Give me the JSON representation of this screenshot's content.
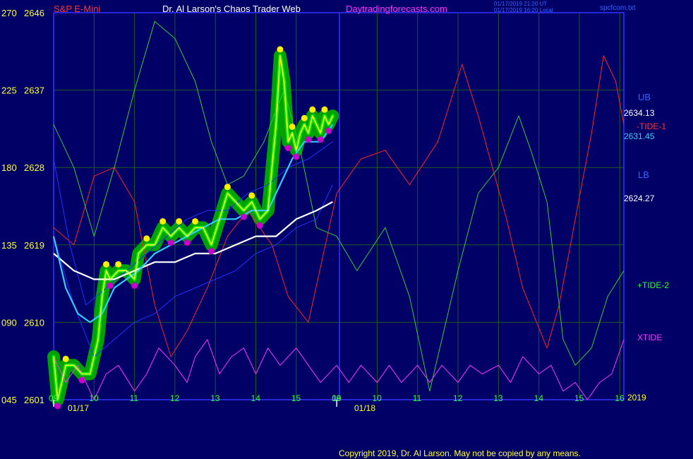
{
  "header": {
    "symbol": "S&P E-Mini",
    "site_title": "Dr. Al Larson's Chaos Trader Web",
    "site_url": "Daytradingforecasts.com",
    "timestamp_line1": "01/17/2019 21:20 UT",
    "timestamp_line2": "01/17/2019 16:20 Local",
    "filename": "spcfcom.txt"
  },
  "footer": {
    "copyright": "Copyright 2019, Dr. Al Larson. May not be copied by any means.",
    "year": "2019"
  },
  "colors": {
    "background": "#000066",
    "plot_border": "#3333ff",
    "grid": "#1b5c1b",
    "tide1": "#ff2222",
    "tide2": "#33cc33",
    "xtide": "#ff33ff",
    "upper_band": "#2233ff",
    "cyan_avg": "#33ccff",
    "white_avg": "#ffffff",
    "price_yellow": "#ffff33",
    "halo_green": "#00aa00",
    "highs": "#ffee00",
    "lows": "#cc00cc"
  },
  "chart_data": {
    "type": "line",
    "title": "S&P E-Mini",
    "left_axis_ticks": [
      "270",
      "225",
      "180",
      "135",
      "090",
      "045"
    ],
    "price_axis_ticks": [
      "2646",
      "2637",
      "2628",
      "2619",
      "2610",
      "2601"
    ],
    "price_range": [
      2601,
      2646
    ],
    "hour_ticks_day1": [
      "09",
      "10",
      "11",
      "12",
      "13",
      "14",
      "15",
      "16"
    ],
    "hour_ticks_day2": [
      "09",
      "10",
      "11",
      "12",
      "13",
      "14",
      "15",
      "16"
    ],
    "dates": [
      "01/17",
      "01/18"
    ],
    "right_labels": {
      "ub": "UB",
      "ub_value": "2634.13",
      "tide1": "-TIDE-1",
      "cyan_value": "2631.45",
      "lb": "LB",
      "lb_value": "2624.27",
      "tide2": "+TIDE-2",
      "xtide": "XTIDE"
    },
    "series": [
      {
        "name": "-TIDE-1",
        "points": [
          [
            9.0,
            2621
          ],
          [
            9.5,
            2619
          ],
          [
            10.0,
            2627
          ],
          [
            10.5,
            2628
          ],
          [
            11.0,
            2624
          ],
          [
            11.5,
            2612
          ],
          [
            11.9,
            2606
          ],
          [
            12.3,
            2609
          ],
          [
            12.8,
            2614
          ],
          [
            13.3,
            2620
          ],
          [
            13.8,
            2623
          ],
          [
            14.4,
            2619
          ],
          [
            14.8,
            2613
          ],
          [
            15.3,
            2610
          ],
          [
            16.0,
            2625
          ],
          [
            16.6,
            2629
          ],
          [
            17.2,
            2630
          ],
          [
            17.8,
            2626
          ],
          [
            18.5,
            2631
          ],
          [
            19.1,
            2640
          ],
          [
            19.5,
            2634
          ],
          [
            20.2,
            2622
          ],
          [
            20.6,
            2614
          ],
          [
            21.2,
            2607
          ],
          [
            21.5,
            2612
          ],
          [
            21.9,
            2622
          ],
          [
            22.3,
            2632
          ],
          [
            22.6,
            2641
          ],
          [
            22.9,
            2638
          ],
          [
            23.1,
            2633
          ]
        ]
      },
      {
        "name": "+TIDE-2",
        "points": [
          [
            9.0,
            2633
          ],
          [
            9.5,
            2628
          ],
          [
            10.0,
            2620
          ],
          [
            10.5,
            2628
          ],
          [
            11.0,
            2637
          ],
          [
            11.5,
            2645
          ],
          [
            12.0,
            2643
          ],
          [
            12.5,
            2638
          ],
          [
            12.9,
            2631
          ],
          [
            13.3,
            2626
          ],
          [
            13.7,
            2627
          ],
          [
            14.2,
            2631
          ],
          [
            14.7,
            2637
          ],
          [
            15.1,
            2630
          ],
          [
            15.5,
            2621
          ],
          [
            16.0,
            2620
          ],
          [
            16.5,
            2616
          ],
          [
            17.2,
            2621
          ],
          [
            17.8,
            2613
          ],
          [
            18.3,
            2602
          ],
          [
            18.5,
            2606
          ],
          [
            19.0,
            2616
          ],
          [
            19.5,
            2625
          ],
          [
            20.0,
            2628
          ],
          [
            20.5,
            2634
          ],
          [
            20.8,
            2630
          ],
          [
            21.2,
            2624
          ],
          [
            21.6,
            2608
          ],
          [
            21.9,
            2605
          ],
          [
            22.3,
            2607
          ],
          [
            22.7,
            2613
          ],
          [
            23.1,
            2616
          ]
        ]
      },
      {
        "name": "XTIDE",
        "points": [
          [
            9.0,
            2606
          ],
          [
            9.3,
            2603
          ],
          [
            9.6,
            2605
          ],
          [
            10.0,
            2601
          ],
          [
            10.3,
            2604
          ],
          [
            10.6,
            2605
          ],
          [
            11.0,
            2602
          ],
          [
            11.3,
            2604
          ],
          [
            11.6,
            2607
          ],
          [
            12.0,
            2605
          ],
          [
            12.3,
            2603
          ],
          [
            12.5,
            2606
          ],
          [
            12.8,
            2608
          ],
          [
            13.1,
            2604
          ],
          [
            13.4,
            2606
          ],
          [
            13.7,
            2607
          ],
          [
            14.0,
            2604
          ],
          [
            14.3,
            2607
          ],
          [
            14.6,
            2605
          ],
          [
            15.0,
            2607
          ],
          [
            15.3,
            2605
          ],
          [
            15.6,
            2603
          ],
          [
            16.0,
            2605
          ],
          [
            16.3,
            2603
          ],
          [
            16.6,
            2605
          ],
          [
            17.0,
            2603
          ],
          [
            17.3,
            2605
          ],
          [
            17.6,
            2603
          ],
          [
            18.0,
            2605
          ],
          [
            18.3,
            2603
          ],
          [
            18.6,
            2605
          ],
          [
            19.0,
            2603
          ],
          [
            19.3,
            2605
          ],
          [
            19.6,
            2604
          ],
          [
            20.0,
            2605
          ],
          [
            20.3,
            2603
          ],
          [
            20.6,
            2606
          ],
          [
            21.0,
            2604
          ],
          [
            21.3,
            2605
          ],
          [
            21.6,
            2602
          ],
          [
            21.9,
            2603
          ],
          [
            22.2,
            2601
          ],
          [
            22.5,
            2603
          ],
          [
            22.8,
            2604
          ],
          [
            23.1,
            2608
          ]
        ]
      },
      {
        "name": "Upper band",
        "points": [
          [
            9.0,
            2629
          ],
          [
            9.4,
            2619
          ],
          [
            9.8,
            2612
          ],
          [
            10.3,
            2614
          ],
          [
            10.8,
            2616
          ],
          [
            11.3,
            2618
          ],
          [
            11.8,
            2620
          ],
          [
            12.3,
            2622
          ],
          [
            12.8,
            2623
          ],
          [
            13.3,
            2623
          ],
          [
            13.8,
            2625
          ],
          [
            14.3,
            2626
          ],
          [
            14.8,
            2628
          ],
          [
            15.3,
            2629
          ],
          [
            15.9,
            2631
          ]
        ]
      },
      {
        "name": "Lower band",
        "points": [
          [
            9.0,
            2620
          ],
          [
            9.5,
            2612
          ],
          [
            10.0,
            2606
          ],
          [
            10.5,
            2608
          ],
          [
            11.0,
            2610
          ],
          [
            11.5,
            2611
          ],
          [
            12.0,
            2613
          ],
          [
            12.5,
            2614
          ],
          [
            13.0,
            2615
          ],
          [
            13.5,
            2616
          ],
          [
            14.0,
            2618
          ],
          [
            14.5,
            2619
          ],
          [
            15.0,
            2621
          ],
          [
            15.5,
            2622
          ],
          [
            15.9,
            2626
          ]
        ]
      },
      {
        "name": "Cyan average",
        "points": [
          [
            9.0,
            2620
          ],
          [
            9.3,
            2614
          ],
          [
            9.6,
            2611
          ],
          [
            9.9,
            2610
          ],
          [
            10.2,
            2611
          ],
          [
            10.5,
            2614
          ],
          [
            10.8,
            2615
          ],
          [
            11.1,
            2616
          ],
          [
            11.5,
            2618
          ],
          [
            11.9,
            2619
          ],
          [
            12.3,
            2620
          ],
          [
            12.7,
            2621
          ],
          [
            13.1,
            2622
          ],
          [
            13.5,
            2622
          ],
          [
            13.9,
            2623
          ],
          [
            14.3,
            2623
          ],
          [
            14.6,
            2626
          ],
          [
            14.9,
            2629
          ],
          [
            15.2,
            2631
          ],
          [
            15.6,
            2631
          ],
          [
            15.9,
            2633
          ]
        ]
      },
      {
        "name": "White average",
        "points": [
          [
            9.0,
            2618
          ],
          [
            9.5,
            2616
          ],
          [
            10.0,
            2615
          ],
          [
            10.5,
            2615
          ],
          [
            11.0,
            2616
          ],
          [
            11.5,
            2617
          ],
          [
            12.0,
            2617
          ],
          [
            12.5,
            2618
          ],
          [
            13.0,
            2618
          ],
          [
            13.5,
            2619
          ],
          [
            14.0,
            2620
          ],
          [
            14.5,
            2620
          ],
          [
            15.0,
            2622
          ],
          [
            15.5,
            2623
          ],
          [
            15.9,
            2624
          ]
        ]
      },
      {
        "name": "Price",
        "points": [
          [
            9.0,
            2606
          ],
          [
            9.1,
            2601
          ],
          [
            9.2,
            2603
          ],
          [
            9.3,
            2605
          ],
          [
            9.5,
            2605
          ],
          [
            9.7,
            2604
          ],
          [
            9.9,
            2604
          ],
          [
            10.1,
            2608
          ],
          [
            10.2,
            2613
          ],
          [
            10.3,
            2616
          ],
          [
            10.4,
            2615
          ],
          [
            10.6,
            2616
          ],
          [
            10.8,
            2616
          ],
          [
            11.0,
            2615
          ],
          [
            11.1,
            2618
          ],
          [
            11.3,
            2619
          ],
          [
            11.5,
            2619
          ],
          [
            11.7,
            2621
          ],
          [
            11.9,
            2620
          ],
          [
            12.1,
            2621
          ],
          [
            12.3,
            2620
          ],
          [
            12.5,
            2621
          ],
          [
            12.7,
            2621
          ],
          [
            12.9,
            2619
          ],
          [
            13.1,
            2622
          ],
          [
            13.3,
            2625
          ],
          [
            13.5,
            2624
          ],
          [
            13.7,
            2623
          ],
          [
            13.9,
            2624
          ],
          [
            14.1,
            2622
          ],
          [
            14.3,
            2623
          ],
          [
            14.4,
            2628
          ],
          [
            14.5,
            2633
          ],
          [
            14.6,
            2641
          ],
          [
            14.7,
            2638
          ],
          [
            14.8,
            2631
          ],
          [
            14.9,
            2632
          ],
          [
            15.0,
            2630
          ],
          [
            15.1,
            2632
          ],
          [
            15.2,
            2633
          ],
          [
            15.3,
            2632
          ],
          [
            15.4,
            2634
          ],
          [
            15.5,
            2633
          ],
          [
            15.6,
            2632
          ],
          [
            15.7,
            2634
          ],
          [
            15.8,
            2633
          ],
          [
            15.9,
            2634
          ]
        ]
      }
    ]
  }
}
